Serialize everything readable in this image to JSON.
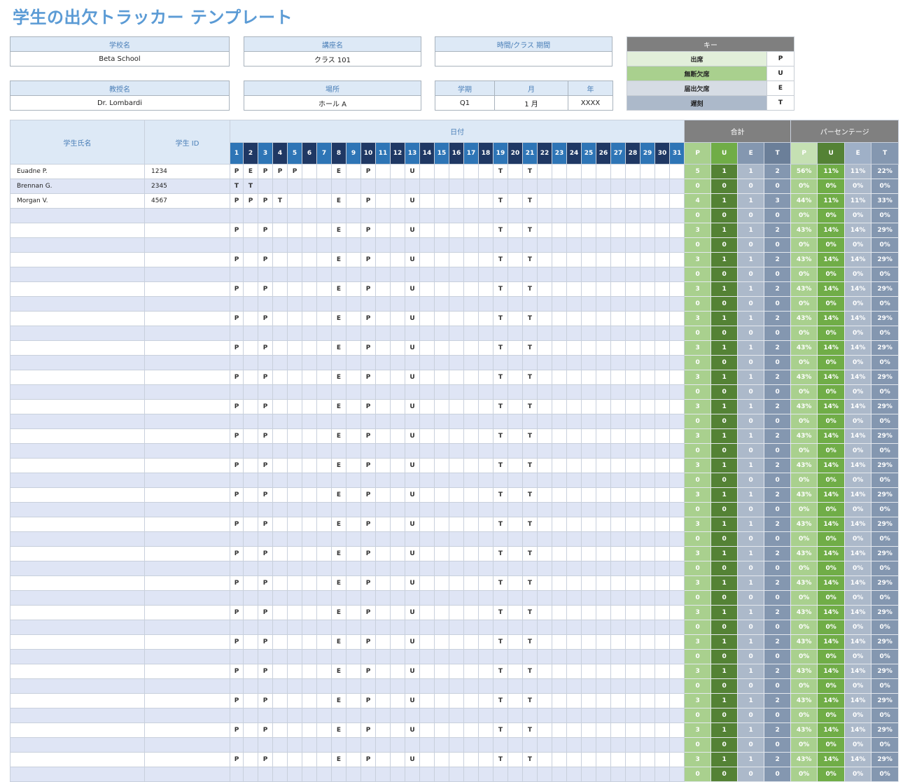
{
  "title": "学生の出欠トラッカー テンプレート",
  "info": {
    "school_label": "学校名",
    "school": "Beta School",
    "course_label": "講座名",
    "course": "クラス 101",
    "time_label": "時間/クラス 期間",
    "time": "",
    "teacher_label": "教授名",
    "teacher": "Dr. Lombardi",
    "place_label": "場所",
    "place": "ホール A",
    "term_label": "学期",
    "term": "Q1",
    "month_label": "月",
    "month": "1 月",
    "year_label": "年",
    "year": "XXXX"
  },
  "key": {
    "header": "キー",
    "rows": [
      {
        "label": "出席",
        "code": "P",
        "color": "#e2efda"
      },
      {
        "label": "無断欠席",
        "code": "U",
        "color": "#a9d08e"
      },
      {
        "label": "届出欠席",
        "code": "E",
        "color": "#d6dce4"
      },
      {
        "label": "遅刻",
        "code": "T",
        "color": "#acb9ca"
      }
    ]
  },
  "grid": {
    "name_header": "学生氏名",
    "id_header": "学生 ID",
    "date_header": "日付",
    "total_header": "合計",
    "percent_header": "パーセンテージ",
    "days": [
      "1",
      "2",
      "3",
      "4",
      "5",
      "6",
      "7",
      "8",
      "9",
      "10",
      "11",
      "12",
      "13",
      "14",
      "15",
      "16",
      "17",
      "18",
      "19",
      "20",
      "21",
      "22",
      "23",
      "24",
      "25",
      "26",
      "27",
      "28",
      "29",
      "30",
      "31"
    ],
    "stat_labels": [
      "P",
      "U",
      "E",
      "T",
      "P",
      "U",
      "E",
      "T"
    ],
    "stat_colors": [
      "#a9d08e",
      "#70ad47",
      "#8497b0",
      "#6b7f99",
      "#c5e0b3",
      "#548235",
      "#9fb0c7",
      "#8497b0"
    ],
    "total_colors": [
      "#a9d08e",
      "#548235",
      "#acb9ca",
      "#8497b0"
    ],
    "percent_colors": [
      "#a9d08e",
      "#70ad47",
      "#acb9ca",
      "#8497b0"
    ],
    "rows": [
      {
        "name": "Euadne P.",
        "id": "1234",
        "marks": {
          "1": "P",
          "2": "E",
          "3": "P",
          "4": "P",
          "5": "P",
          "8": "E",
          "10": "P",
          "13": "U",
          "19": "T",
          "21": "T"
        },
        "totals": [
          "5",
          "1",
          "1",
          "2"
        ],
        "percents": [
          "56%",
          "11%",
          "11%",
          "22%"
        ]
      },
      {
        "name": "Brennan G.",
        "id": "2345",
        "marks": {
          "1": "T",
          "2": "T"
        },
        "totals": [
          "0",
          "0",
          "0",
          "0"
        ],
        "percents": [
          "0%",
          "0%",
          "0%",
          "0%"
        ]
      },
      {
        "name": "Morgan V.",
        "id": "4567",
        "marks": {
          "1": "P",
          "2": "P",
          "3": "P",
          "4": "T",
          "8": "E",
          "10": "P",
          "13": "U",
          "19": "T",
          "21": "T"
        },
        "totals": [
          "4",
          "1",
          "1",
          "3"
        ],
        "percents": [
          "44%",
          "11%",
          "11%",
          "33%"
        ]
      },
      {
        "name": "",
        "id": "",
        "marks": {},
        "totals": [
          "0",
          "0",
          "0",
          "0"
        ],
        "percents": [
          "0%",
          "0%",
          "0%",
          "0%"
        ]
      },
      {
        "name": "",
        "id": "",
        "marks": {
          "1": "P",
          "3": "P",
          "8": "E",
          "10": "P",
          "13": "U",
          "19": "T",
          "21": "T"
        },
        "totals": [
          "3",
          "1",
          "1",
          "2"
        ],
        "percents": [
          "43%",
          "14%",
          "14%",
          "29%"
        ]
      },
      {
        "name": "",
        "id": "",
        "marks": {},
        "totals": [
          "0",
          "0",
          "0",
          "0"
        ],
        "percents": [
          "0%",
          "0%",
          "0%",
          "0%"
        ]
      },
      {
        "name": "",
        "id": "",
        "marks": {
          "1": "P",
          "3": "P",
          "8": "E",
          "10": "P",
          "13": "U",
          "19": "T",
          "21": "T"
        },
        "totals": [
          "3",
          "1",
          "1",
          "2"
        ],
        "percents": [
          "43%",
          "14%",
          "14%",
          "29%"
        ]
      },
      {
        "name": "",
        "id": "",
        "marks": {},
        "totals": [
          "0",
          "0",
          "0",
          "0"
        ],
        "percents": [
          "0%",
          "0%",
          "0%",
          "0%"
        ]
      },
      {
        "name": "",
        "id": "",
        "marks": {
          "1": "P",
          "3": "P",
          "8": "E",
          "10": "P",
          "13": "U",
          "19": "T",
          "21": "T"
        },
        "totals": [
          "3",
          "1",
          "1",
          "2"
        ],
        "percents": [
          "43%",
          "14%",
          "14%",
          "29%"
        ]
      },
      {
        "name": "",
        "id": "",
        "marks": {},
        "totals": [
          "0",
          "0",
          "0",
          "0"
        ],
        "percents": [
          "0%",
          "0%",
          "0%",
          "0%"
        ]
      },
      {
        "name": "",
        "id": "",
        "marks": {
          "1": "P",
          "3": "P",
          "8": "E",
          "10": "P",
          "13": "U",
          "19": "T",
          "21": "T"
        },
        "totals": [
          "3",
          "1",
          "1",
          "2"
        ],
        "percents": [
          "43%",
          "14%",
          "14%",
          "29%"
        ]
      },
      {
        "name": "",
        "id": "",
        "marks": {},
        "totals": [
          "0",
          "0",
          "0",
          "0"
        ],
        "percents": [
          "0%",
          "0%",
          "0%",
          "0%"
        ]
      },
      {
        "name": "",
        "id": "",
        "marks": {
          "1": "P",
          "3": "P",
          "8": "E",
          "10": "P",
          "13": "U",
          "19": "T",
          "21": "T"
        },
        "totals": [
          "3",
          "1",
          "1",
          "2"
        ],
        "percents": [
          "43%",
          "14%",
          "14%",
          "29%"
        ]
      },
      {
        "name": "",
        "id": "",
        "marks": {},
        "totals": [
          "0",
          "0",
          "0",
          "0"
        ],
        "percents": [
          "0%",
          "0%",
          "0%",
          "0%"
        ]
      },
      {
        "name": "",
        "id": "",
        "marks": {
          "1": "P",
          "3": "P",
          "8": "E",
          "10": "P",
          "13": "U",
          "19": "T",
          "21": "T"
        },
        "totals": [
          "3",
          "1",
          "1",
          "2"
        ],
        "percents": [
          "43%",
          "14%",
          "14%",
          "29%"
        ]
      },
      {
        "name": "",
        "id": "",
        "marks": {},
        "totals": [
          "0",
          "0",
          "0",
          "0"
        ],
        "percents": [
          "0%",
          "0%",
          "0%",
          "0%"
        ]
      },
      {
        "name": "",
        "id": "",
        "marks": {
          "1": "P",
          "3": "P",
          "8": "E",
          "10": "P",
          "13": "U",
          "19": "T",
          "21": "T"
        },
        "totals": [
          "3",
          "1",
          "1",
          "2"
        ],
        "percents": [
          "43%",
          "14%",
          "14%",
          "29%"
        ]
      },
      {
        "name": "",
        "id": "",
        "marks": {},
        "totals": [
          "0",
          "0",
          "0",
          "0"
        ],
        "percents": [
          "0%",
          "0%",
          "0%",
          "0%"
        ]
      },
      {
        "name": "",
        "id": "",
        "marks": {
          "1": "P",
          "3": "P",
          "8": "E",
          "10": "P",
          "13": "U",
          "19": "T",
          "21": "T"
        },
        "totals": [
          "3",
          "1",
          "1",
          "2"
        ],
        "percents": [
          "43%",
          "14%",
          "14%",
          "29%"
        ]
      },
      {
        "name": "",
        "id": "",
        "marks": {},
        "totals": [
          "0",
          "0",
          "0",
          "0"
        ],
        "percents": [
          "0%",
          "0%",
          "0%",
          "0%"
        ]
      },
      {
        "name": "",
        "id": "",
        "marks": {
          "1": "P",
          "3": "P",
          "8": "E",
          "10": "P",
          "13": "U",
          "19": "T",
          "21": "T"
        },
        "totals": [
          "3",
          "1",
          "1",
          "2"
        ],
        "percents": [
          "43%",
          "14%",
          "14%",
          "29%"
        ]
      },
      {
        "name": "",
        "id": "",
        "marks": {},
        "totals": [
          "0",
          "0",
          "0",
          "0"
        ],
        "percents": [
          "0%",
          "0%",
          "0%",
          "0%"
        ]
      },
      {
        "name": "",
        "id": "",
        "marks": {
          "1": "P",
          "3": "P",
          "8": "E",
          "10": "P",
          "13": "U",
          "19": "T",
          "21": "T"
        },
        "totals": [
          "3",
          "1",
          "1",
          "2"
        ],
        "percents": [
          "43%",
          "14%",
          "14%",
          "29%"
        ]
      },
      {
        "name": "",
        "id": "",
        "marks": {},
        "totals": [
          "0",
          "0",
          "0",
          "0"
        ],
        "percents": [
          "0%",
          "0%",
          "0%",
          "0%"
        ]
      },
      {
        "name": "",
        "id": "",
        "marks": {
          "1": "P",
          "3": "P",
          "8": "E",
          "10": "P",
          "13": "U",
          "19": "T",
          "21": "T"
        },
        "totals": [
          "3",
          "1",
          "1",
          "2"
        ],
        "percents": [
          "43%",
          "14%",
          "14%",
          "29%"
        ]
      },
      {
        "name": "",
        "id": "",
        "marks": {},
        "totals": [
          "0",
          "0",
          "0",
          "0"
        ],
        "percents": [
          "0%",
          "0%",
          "0%",
          "0%"
        ]
      },
      {
        "name": "",
        "id": "",
        "marks": {
          "1": "P",
          "3": "P",
          "8": "E",
          "10": "P",
          "13": "U",
          "19": "T",
          "21": "T"
        },
        "totals": [
          "3",
          "1",
          "1",
          "2"
        ],
        "percents": [
          "43%",
          "14%",
          "14%",
          "29%"
        ]
      },
      {
        "name": "",
        "id": "",
        "marks": {},
        "totals": [
          "0",
          "0",
          "0",
          "0"
        ],
        "percents": [
          "0%",
          "0%",
          "0%",
          "0%"
        ]
      },
      {
        "name": "",
        "id": "",
        "marks": {
          "1": "P",
          "3": "P",
          "8": "E",
          "10": "P",
          "13": "U",
          "19": "T",
          "21": "T"
        },
        "totals": [
          "3",
          "1",
          "1",
          "2"
        ],
        "percents": [
          "43%",
          "14%",
          "14%",
          "29%"
        ]
      },
      {
        "name": "",
        "id": "",
        "marks": {},
        "totals": [
          "0",
          "0",
          "0",
          "0"
        ],
        "percents": [
          "0%",
          "0%",
          "0%",
          "0%"
        ]
      },
      {
        "name": "",
        "id": "",
        "marks": {
          "1": "P",
          "3": "P",
          "8": "E",
          "10": "P",
          "13": "U",
          "19": "T",
          "21": "T"
        },
        "totals": [
          "3",
          "1",
          "1",
          "2"
        ],
        "percents": [
          "43%",
          "14%",
          "14%",
          "29%"
        ]
      },
      {
        "name": "",
        "id": "",
        "marks": {},
        "totals": [
          "0",
          "0",
          "0",
          "0"
        ],
        "percents": [
          "0%",
          "0%",
          "0%",
          "0%"
        ]
      },
      {
        "name": "",
        "id": "",
        "marks": {
          "1": "P",
          "3": "P",
          "8": "E",
          "10": "P",
          "13": "U",
          "19": "T",
          "21": "T"
        },
        "totals": [
          "3",
          "1",
          "1",
          "2"
        ],
        "percents": [
          "43%",
          "14%",
          "14%",
          "29%"
        ]
      },
      {
        "name": "",
        "id": "",
        "marks": {},
        "totals": [
          "0",
          "0",
          "0",
          "0"
        ],
        "percents": [
          "0%",
          "0%",
          "0%",
          "0%"
        ]
      },
      {
        "name": "",
        "id": "",
        "marks": {
          "1": "P",
          "3": "P",
          "8": "E",
          "10": "P",
          "13": "U",
          "19": "T",
          "21": "T"
        },
        "totals": [
          "3",
          "1",
          "1",
          "2"
        ],
        "percents": [
          "43%",
          "14%",
          "14%",
          "29%"
        ]
      },
      {
        "name": "",
        "id": "",
        "marks": {},
        "totals": [
          "0",
          "0",
          "0",
          "0"
        ],
        "percents": [
          "0%",
          "0%",
          "0%",
          "0%"
        ]
      },
      {
        "name": "",
        "id": "",
        "marks": {
          "1": "P",
          "3": "P",
          "8": "E",
          "10": "P",
          "13": "U",
          "19": "T",
          "21": "T"
        },
        "totals": [
          "3",
          "1",
          "1",
          "2"
        ],
        "percents": [
          "43%",
          "14%",
          "14%",
          "29%"
        ]
      },
      {
        "name": "",
        "id": "",
        "marks": {},
        "totals": [
          "0",
          "0",
          "0",
          "0"
        ],
        "percents": [
          "0%",
          "0%",
          "0%",
          "0%"
        ]
      },
      {
        "name": "",
        "id": "",
        "marks": {
          "1": "P",
          "3": "P",
          "8": "E",
          "10": "P",
          "13": "U",
          "19": "T",
          "21": "T"
        },
        "totals": [
          "3",
          "1",
          "1",
          "2"
        ],
        "percents": [
          "43%",
          "14%",
          "14%",
          "29%"
        ]
      },
      {
        "name": "",
        "id": "",
        "marks": {},
        "totals": [
          "0",
          "0",
          "0",
          "0"
        ],
        "percents": [
          "0%",
          "0%",
          "0%",
          "0%"
        ]
      },
      {
        "name": "",
        "id": "",
        "marks": {
          "1": "P",
          "3": "P",
          "8": "E",
          "10": "P",
          "13": "U",
          "19": "T",
          "21": "T"
        },
        "totals": [
          "3",
          "1",
          "1",
          "2"
        ],
        "percents": [
          "43%",
          "14%",
          "14%",
          "29%"
        ]
      },
      {
        "name": "",
        "id": "",
        "marks": {},
        "totals": [
          "0",
          "0",
          "0",
          "0"
        ],
        "percents": [
          "0%",
          "0%",
          "0%",
          "0%"
        ]
      }
    ]
  }
}
